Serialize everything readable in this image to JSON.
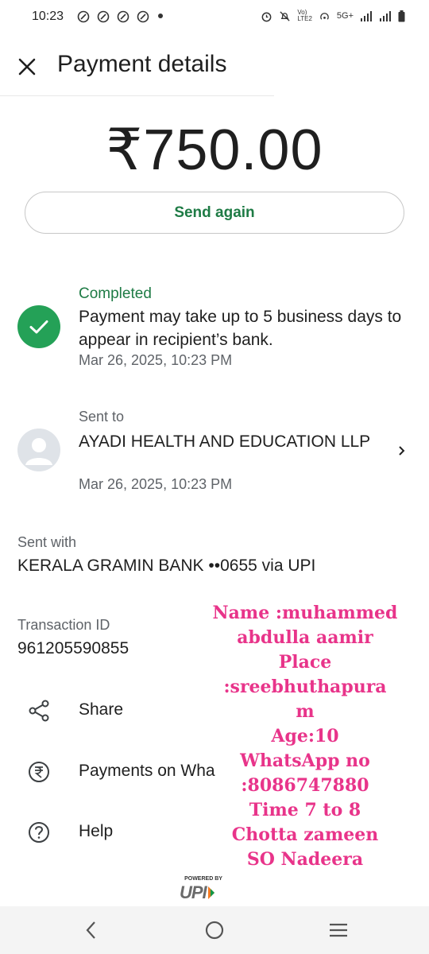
{
  "status_bar": {
    "time": "10:23",
    "network": "5G+"
  },
  "header": {
    "title": "Payment details"
  },
  "payment": {
    "amount": "₹750.00",
    "send_again_label": "Send again"
  },
  "status": {
    "label": "Completed",
    "message": "Payment may take up to 5 business days to appear in recipient’s bank.",
    "date": "Mar 26, 2025, 10:23 PM",
    "accent_color": "#24a157"
  },
  "recipient": {
    "label": "Sent to",
    "name": "AYADI HEALTH AND EDUCATION LLP",
    "date": "Mar 26, 2025, 10:23 PM"
  },
  "sent_with": {
    "label": "Sent with",
    "value": "KERALA GRAMIN BANK ••0655 via UPI"
  },
  "transaction": {
    "label": "Transaction ID",
    "id": "961205590855"
  },
  "actions": [
    {
      "label": "Share",
      "icon": "share-icon"
    },
    {
      "label": "Payments on Wha",
      "icon": "rupee-circle-icon"
    },
    {
      "label": "Help",
      "icon": "help-icon"
    }
  ],
  "overlay_note": {
    "lines": [
      "Name :muhammed",
      "abdulla aamir",
      "Place :sreebhuthapura",
      "m",
      "Age:10",
      "WhatsApp no",
      ":8086747880",
      "Time  7 to 8",
      "Chotta zameen",
      "SO Nadeera"
    ],
    "color": "#e8348a"
  },
  "footer": {
    "powered_by": "POWERED BY",
    "upi": "UPI"
  }
}
